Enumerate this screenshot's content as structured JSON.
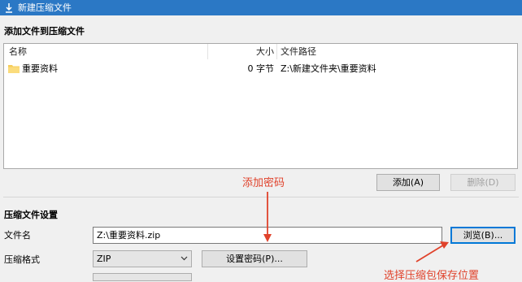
{
  "window": {
    "title": "新建压缩文件"
  },
  "add_section": {
    "title": "添加文件到压缩文件",
    "columns": {
      "name": "名称",
      "size": "大小",
      "path": "文件路径"
    },
    "rows": [
      {
        "name": "重要资料",
        "size": "0 字节",
        "path": "Z:\\新建文件夹\\重要资料"
      }
    ],
    "add_label": "添加(A)",
    "delete_label": "删除(D)"
  },
  "settings": {
    "title": "压缩文件设置",
    "filename_label": "文件名",
    "filename_value": "Z:\\重要资料.zip",
    "browse_label": "浏览(B)...",
    "format_label": "压缩格式",
    "format_value": "ZIP",
    "password_label": "设置密码(P)..."
  },
  "annotations": {
    "add_password": "添加密码",
    "choose_location": "选择压缩包保存位置"
  },
  "colors": {
    "titlebar": "#2b78c5",
    "annotation": "#e0422b",
    "focus": "#0078d7"
  }
}
